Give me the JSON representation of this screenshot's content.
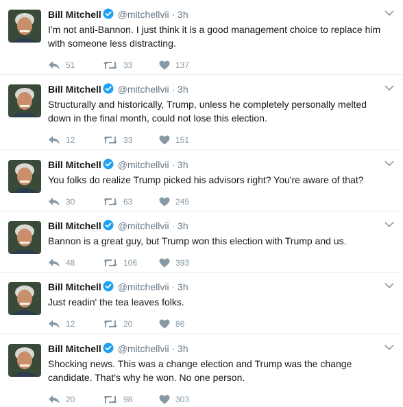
{
  "tweets": [
    {
      "name": "Bill Mitchell",
      "handle": "@mitchellvii",
      "separator": "·",
      "time": "3h",
      "text": "I'm not anti-Bannon.  I just think it is a good management choice to replace him\nwith someone less distracting.",
      "replies": "51",
      "retweets": "33",
      "likes": "137"
    },
    {
      "name": "Bill Mitchell",
      "handle": "@mitchellvii",
      "separator": "·",
      "time": "3h",
      "text": "Structurally and historically, Trump, unless he completely personally melted\ndown in the final month, could not lose this election.",
      "replies": "12",
      "retweets": "33",
      "likes": "151"
    },
    {
      "name": "Bill Mitchell",
      "handle": "@mitchellvii",
      "separator": "·",
      "time": "3h",
      "text": "You folks do realize Trump picked his advisors right?  You're aware of that?",
      "replies": "30",
      "retweets": "63",
      "likes": "245"
    },
    {
      "name": "Bill Mitchell",
      "handle": "@mitchellvii",
      "separator": "·",
      "time": "3h",
      "text": "Bannon is a great guy, but Trump won this election with Trump and us.",
      "replies": "48",
      "retweets": "106",
      "likes": "393"
    },
    {
      "name": "Bill Mitchell",
      "handle": "@mitchellvii",
      "separator": "·",
      "time": "3h",
      "text": "Just readin' the tea leaves folks.",
      "replies": "12",
      "retweets": "20",
      "likes": "86"
    },
    {
      "name": "Bill Mitchell",
      "handle": "@mitchellvii",
      "separator": "·",
      "time": "3h",
      "text": "Shocking news.  This was a change election and Trump was the change\ncandidate.  That's why he won.  No one person.",
      "replies": "20",
      "retweets": "98",
      "likes": "303"
    }
  ],
  "icons": {
    "verified": "verified-badge-icon",
    "menu": "chevron-down-icon",
    "reply": "reply-icon",
    "retweet": "retweet-icon",
    "like": "heart-icon"
  },
  "colors": {
    "verified": "#1da1f2",
    "action": "#8899a6",
    "text": "#14171a",
    "meta": "#657786",
    "divider": "#e6ecf0"
  }
}
